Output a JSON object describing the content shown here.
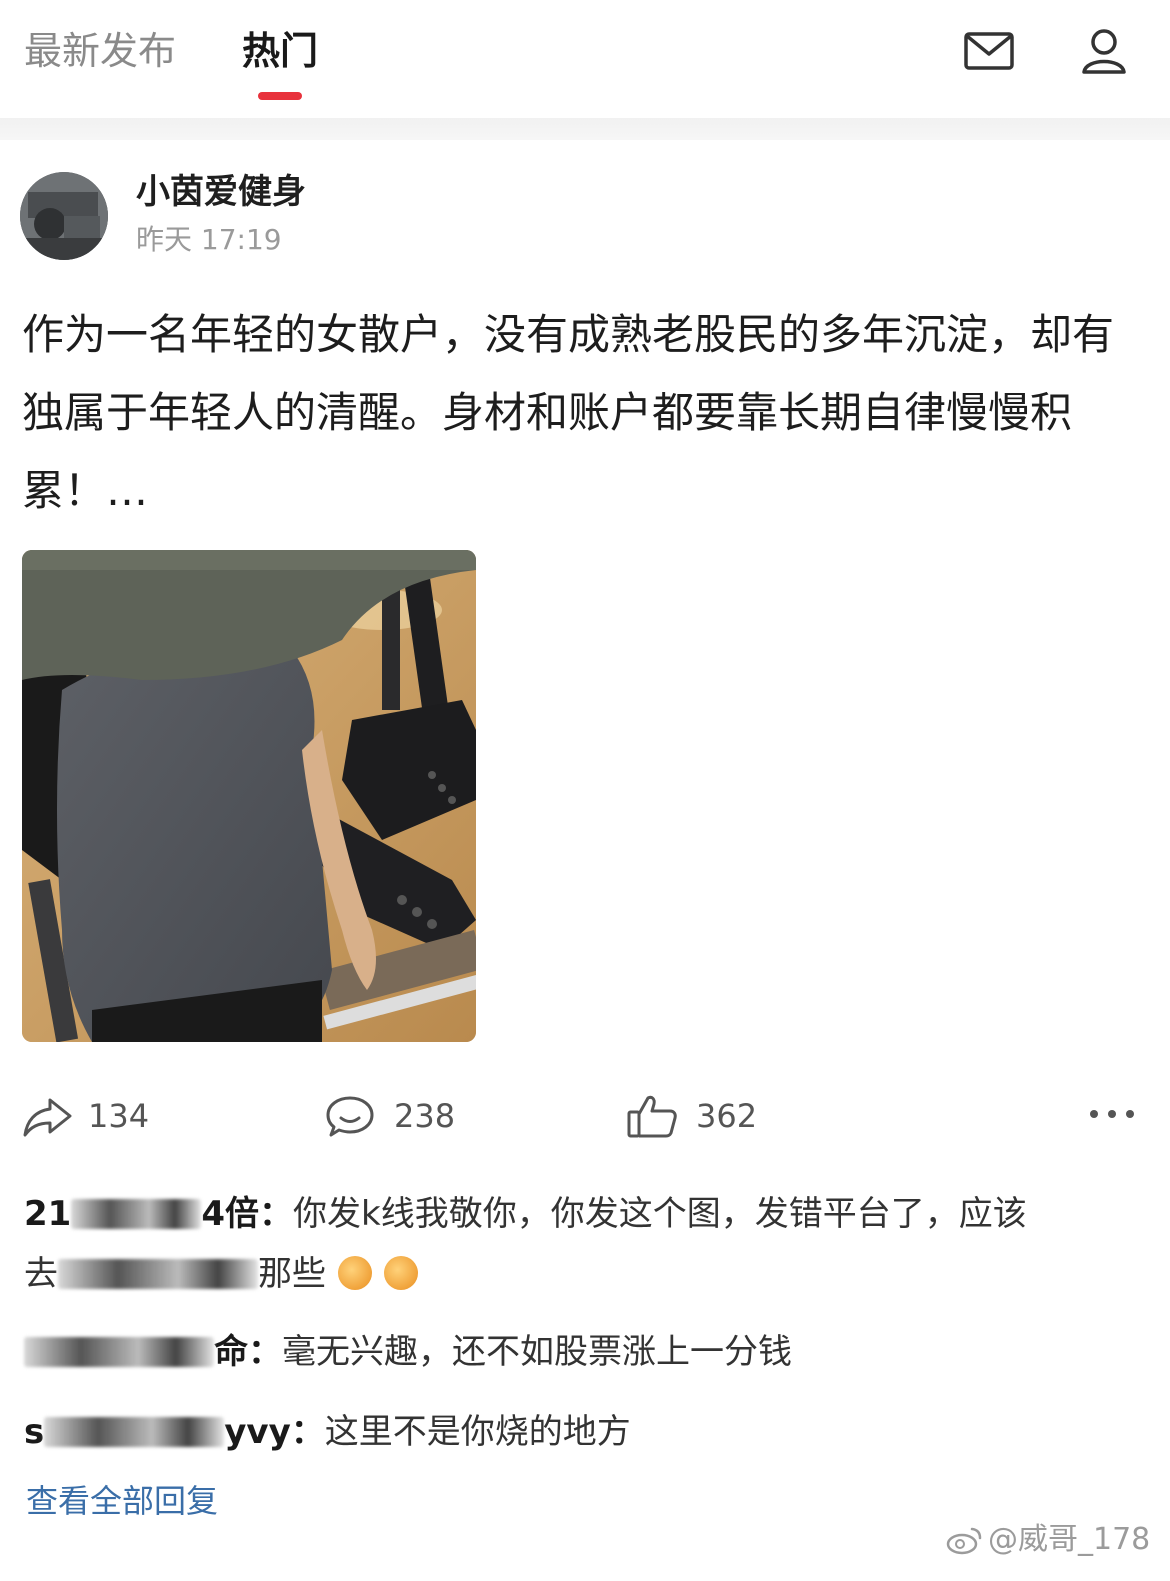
{
  "nav": {
    "tabs": [
      {
        "label": "最新发布",
        "active": false
      },
      {
        "label": "热门",
        "active": true
      }
    ],
    "accent_color": "#e8323c",
    "icons": [
      "mail-icon",
      "user-icon"
    ]
  },
  "post": {
    "author": "小茵爱健身",
    "time": "昨天 17:19",
    "text": "作为一名年轻的女散户，没有成熟老股民的多年沉淀，却有独属于年轻人的清醒。身材和账户都要靠长期自律慢慢积累！…",
    "image": "photo of woman in gray t-shirt at gym machine",
    "actions": {
      "share_count": "134",
      "comment_count": "238",
      "like_count": "362"
    }
  },
  "comments": [
    {
      "user_visible_a": "21",
      "user_visible_b": "4倍",
      "sep": "：",
      "text_line1": "你发k线我敬你，你发这个图，发错平台了，应该",
      "text_line2_a": "去",
      "text_line2_b": "那些"
    },
    {
      "user_visible_b": "命",
      "sep": "：",
      "text": "毫无兴趣，还不如股票涨上一分钱"
    },
    {
      "user_visible_a": "s",
      "user_visible_b": "yvy",
      "sep": "：",
      "text": "这里不是你烧的地方"
    }
  ],
  "view_all_replies": "查看全部回复",
  "watermark": "@威哥_178"
}
